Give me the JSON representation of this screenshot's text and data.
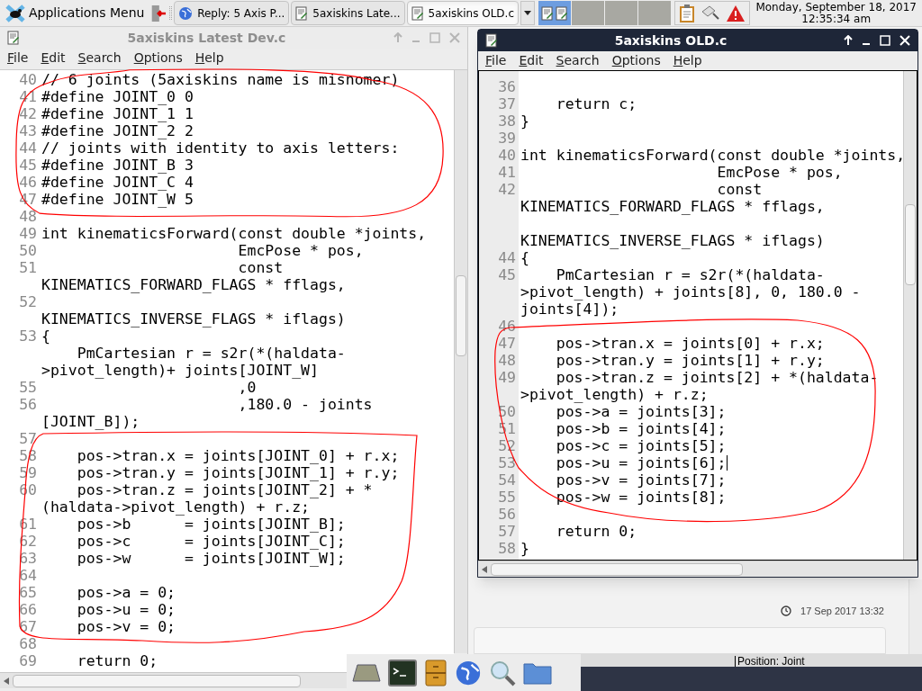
{
  "taskbar": {
    "app_menu": "Applications Menu",
    "tasks": [
      {
        "label": "Reply: 5 Axis P...",
        "kind": "browser",
        "selected": false
      },
      {
        "label": "5axiskins Late...",
        "kind": "editor",
        "selected": false
      },
      {
        "label": "5axiskins OLD.c",
        "kind": "editor",
        "selected": true
      }
    ],
    "workspaces": [
      {
        "selected": true
      },
      {
        "selected": false
      },
      {
        "selected": false
      },
      {
        "selected": false
      }
    ],
    "clock": {
      "date": "Monday, September 18, 2017",
      "time": "12:35:34 am"
    }
  },
  "background_page": {
    "timestamp": "17 Sep 2017 13:32",
    "field_label": "Position: Joint"
  },
  "windows": [
    {
      "title": "5axiskins Latest Dev.c",
      "active": false,
      "menu": [
        "File",
        "Edit",
        "Search",
        "Options",
        "Help"
      ],
      "lines": [
        {
          "num": "40",
          "rows": [
            "// 6 joints (5axiskins name is misnomer)"
          ]
        },
        {
          "num": "41",
          "rows": [
            "#define JOINT_0 0"
          ]
        },
        {
          "num": "42",
          "rows": [
            "#define JOINT_1 1"
          ]
        },
        {
          "num": "43",
          "rows": [
            "#define JOINT_2 2"
          ]
        },
        {
          "num": "44",
          "rows": [
            "// joints with identity to axis letters:"
          ]
        },
        {
          "num": "45",
          "rows": [
            "#define JOINT_B 3"
          ]
        },
        {
          "num": "46",
          "rows": [
            "#define JOINT_C 4"
          ]
        },
        {
          "num": "47",
          "rows": [
            "#define JOINT_W 5"
          ]
        },
        {
          "num": "48"
        },
        {
          "num": "49",
          "rows": [
            "int kinematicsForward(const double *joints,"
          ]
        },
        {
          "num": "50",
          "rows": [
            "                      EmcPose * pos,"
          ]
        },
        {
          "num": "51",
          "rows": [
            "                      const",
            "KINEMATICS_FORWARD_FLAGS * fflags,"
          ]
        },
        {
          "num": "52",
          "blank_first_row": true,
          "rows": [
            "KINEMATICS_INVERSE_FLAGS * iflags)"
          ]
        },
        {
          "num": "53",
          "rows": [
            "{"
          ]
        },
        {
          "rows": [
            "    PmCartesian r = s2r(*(haldata-",
            ">pivot_length)+ joints[JOINT_W]"
          ]
        },
        {
          "num": "55",
          "rows": [
            "                      ,0"
          ]
        },
        {
          "num": "56",
          "rows": [
            "                      ,180.0 - joints",
            "[JOINT_B]);"
          ]
        },
        {
          "num": "57"
        },
        {
          "num": "58",
          "rows": [
            "    pos->tran.x = joints[JOINT_0] + r.x;"
          ]
        },
        {
          "num": "59",
          "rows": [
            "    pos->tran.y = joints[JOINT_1] + r.y;"
          ]
        },
        {
          "num": "60",
          "rows": [
            "    pos->tran.z = joints[JOINT_2] + *",
            "(haldata->pivot_length) + r.z;"
          ]
        },
        {
          "num": "61",
          "rows": [
            "    pos->b      = joints[JOINT_B];"
          ]
        },
        {
          "num": "62",
          "rows": [
            "    pos->c      = joints[JOINT_C];"
          ]
        },
        {
          "num": "63",
          "rows": [
            "    pos->w      = joints[JOINT_W];"
          ]
        },
        {
          "num": "64"
        },
        {
          "num": "65",
          "rows": [
            "    pos->a = 0;"
          ]
        },
        {
          "num": "66",
          "rows": [
            "    pos->u = 0;"
          ]
        },
        {
          "num": "67",
          "rows": [
            "    pos->v = 0;"
          ]
        },
        {
          "num": "68"
        },
        {
          "num": "69",
          "rows": [
            "    return 0;"
          ]
        }
      ]
    },
    {
      "title": "5axiskins OLD.c",
      "active": true,
      "menu": [
        "File",
        "Edit",
        "Search",
        "Options",
        "Help"
      ],
      "lines": [
        {
          "num": "36"
        },
        {
          "num": "37",
          "rows": [
            "    return c;"
          ]
        },
        {
          "num": "38",
          "rows": [
            "}"
          ]
        },
        {
          "num": "39"
        },
        {
          "num": "40",
          "rows": [
            "int kinematicsForward(const double *joints,"
          ]
        },
        {
          "num": "41",
          "rows": [
            "                      EmcPose * pos,"
          ]
        },
        {
          "num": "42",
          "rows": [
            "                      const",
            "KINEMATICS_FORWARD_FLAGS * fflags,"
          ]
        },
        {
          "blank_first_row": true,
          "rows": [
            "KINEMATICS_INVERSE_FLAGS * iflags)"
          ]
        },
        {
          "num": "44",
          "rows": [
            "{"
          ]
        },
        {
          "num": "45",
          "rows": [
            "    PmCartesian r = s2r(*(haldata-",
            ">pivot_length) + joints[8], 0, 180.0 -",
            "joints[4]);"
          ]
        },
        {
          "num": "46"
        },
        {
          "num": "47",
          "rows": [
            "    pos->tran.x = joints[0] + r.x;"
          ]
        },
        {
          "num": "48",
          "rows": [
            "    pos->tran.y = joints[1] + r.y;"
          ]
        },
        {
          "num": "49",
          "rows": [
            "    pos->tran.z = joints[2] + *(haldata-",
            ">pivot_length) + r.z;"
          ]
        },
        {
          "num": "50",
          "rows": [
            "    pos->a = joints[3];"
          ]
        },
        {
          "num": "51",
          "rows": [
            "    pos->b = joints[4];"
          ]
        },
        {
          "num": "52",
          "rows": [
            "    pos->c = joints[5];"
          ]
        },
        {
          "num": "53",
          "cursor": true,
          "rows": [
            "    pos->u = joints[6];"
          ]
        },
        {
          "num": "54",
          "rows": [
            "    pos->v = joints[7];"
          ]
        },
        {
          "num": "55",
          "rows": [
            "    pos->w = joints[8];"
          ]
        },
        {
          "num": "56"
        },
        {
          "num": "57",
          "rows": [
            "    return 0;"
          ]
        },
        {
          "num": "58",
          "rows": [
            "}"
          ]
        }
      ]
    }
  ]
}
